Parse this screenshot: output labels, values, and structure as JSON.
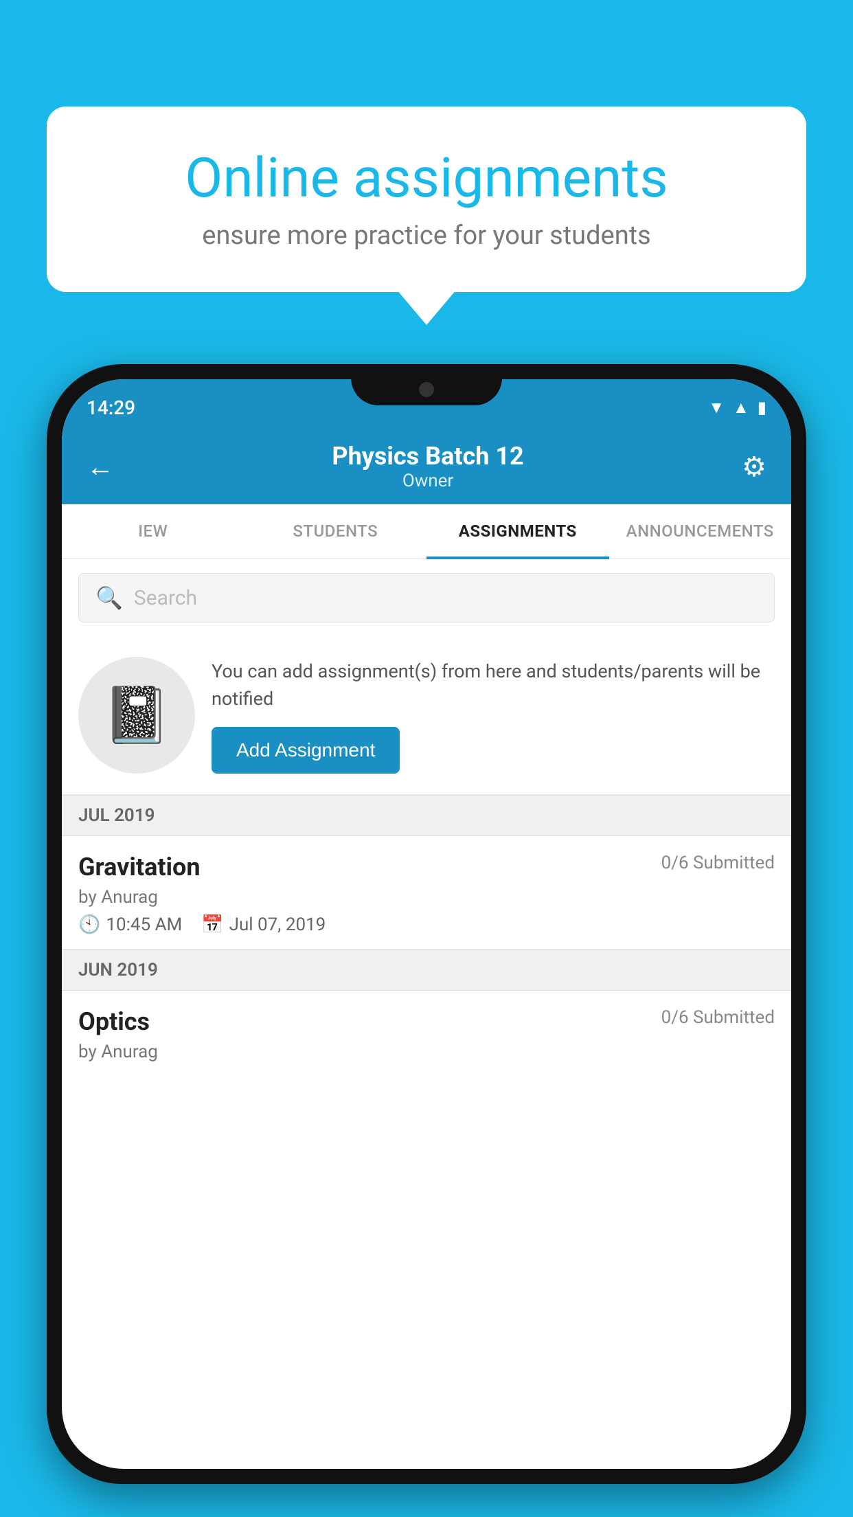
{
  "background_color": "#1ab8e8",
  "speech_bubble": {
    "title": "Online assignments",
    "subtitle": "ensure more practice for your students"
  },
  "status_bar": {
    "time": "14:29",
    "icons": [
      "wifi",
      "signal",
      "battery"
    ]
  },
  "header": {
    "title": "Physics Batch 12",
    "subtitle": "Owner",
    "back_label": "←",
    "gear_label": "⚙"
  },
  "tabs": [
    {
      "label": "IEW",
      "active": false
    },
    {
      "label": "STUDENTS",
      "active": false
    },
    {
      "label": "ASSIGNMENTS",
      "active": true
    },
    {
      "label": "ANNOUNCEMENTS",
      "active": false
    }
  ],
  "search": {
    "placeholder": "Search"
  },
  "promo": {
    "text": "You can add assignment(s) from here and students/parents will be notified",
    "button_label": "Add Assignment"
  },
  "sections": [
    {
      "label": "JUL 2019",
      "assignments": [
        {
          "title": "Gravitation",
          "submitted": "0/6 Submitted",
          "by": "by Anurag",
          "time": "10:45 AM",
          "date": "Jul 07, 2019"
        }
      ]
    },
    {
      "label": "JUN 2019",
      "assignments": [
        {
          "title": "Optics",
          "submitted": "0/6 Submitted",
          "by": "by Anurag",
          "time": "",
          "date": ""
        }
      ]
    }
  ]
}
